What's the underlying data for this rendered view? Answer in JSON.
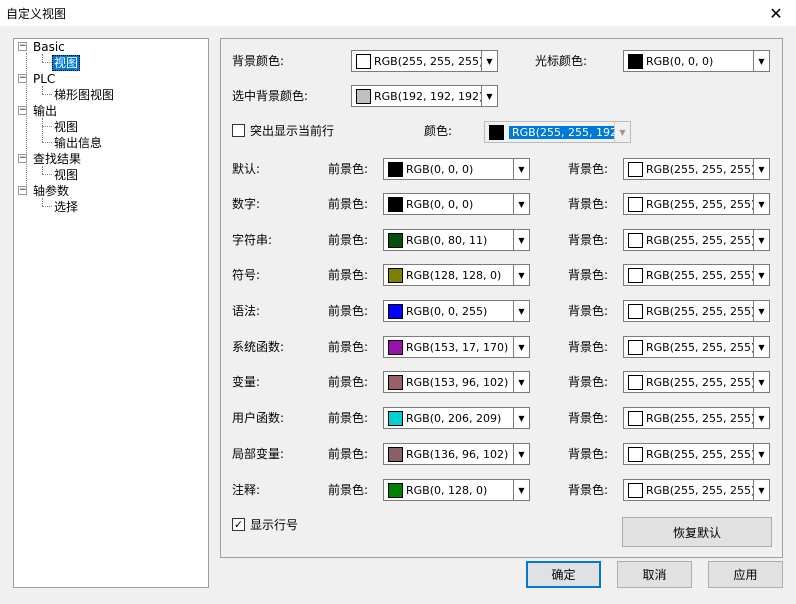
{
  "window": {
    "title": "自定义视图",
    "close_glyph": "✕"
  },
  "tree": [
    {
      "label": "Basic",
      "expander": "−"
    },
    {
      "label": "视图"
    },
    {
      "label": "PLC",
      "expander": "−"
    },
    {
      "label": "梯形图视图"
    },
    {
      "label": "输出",
      "expander": "−"
    },
    {
      "label": "视图"
    },
    {
      "label": "输出信息"
    },
    {
      "label": "查找结果",
      "expander": "−"
    },
    {
      "label": "视图"
    },
    {
      "label": "轴参数",
      "expander": "−"
    },
    {
      "label": "选择"
    }
  ],
  "top": {
    "bg_label": "背景颜色:",
    "bg_value": "RGB(255, 255, 255)",
    "bg_color": "#ffffff",
    "cursor_label": "光标颜色:",
    "cursor_value": "RGB(0, 0, 0)",
    "cursor_color": "#000000",
    "selbg_label": "选中背景颜色:",
    "selbg_value": "RGB(192, 192, 192)",
    "selbg_color": "#c0c0c0",
    "highlight_label": "突出显示当前行",
    "highlight_checked": false,
    "color_label": "颜色:",
    "color_value": "RGB(255, 255, 192)",
    "color_color": "#000000"
  },
  "fg_label": "前景色:",
  "bgc_label": "背景色:",
  "rows": [
    {
      "name": "默认:",
      "fg": "RGB(0, 0, 0)",
      "fg_color": "#000000",
      "bg": "RGB(255, 255, 255)",
      "bg_color": "#ffffff"
    },
    {
      "name": "数字:",
      "fg": "RGB(0, 0, 0)",
      "fg_color": "#000000",
      "bg": "RGB(255, 255, 255)",
      "bg_color": "#ffffff"
    },
    {
      "name": "字符串:",
      "fg": "RGB(0, 80, 11)",
      "fg_color": "#00500b",
      "bg": "RGB(255, 255, 255)",
      "bg_color": "#ffffff"
    },
    {
      "name": "符号:",
      "fg": "RGB(128, 128, 0)",
      "fg_color": "#808000",
      "bg": "RGB(255, 255, 255)",
      "bg_color": "#ffffff"
    },
    {
      "name": "语法:",
      "fg": "RGB(0, 0, 255)",
      "fg_color": "#0000ff",
      "bg": "RGB(255, 255, 255)",
      "bg_color": "#ffffff"
    },
    {
      "name": "系统函数:",
      "fg": "RGB(153, 17, 170)",
      "fg_color": "#9911aa",
      "bg": "RGB(255, 255, 255)",
      "bg_color": "#ffffff"
    },
    {
      "name": "变量:",
      "fg": "RGB(153, 96, 102)",
      "fg_color": "#996066",
      "bg": "RGB(255, 255, 255)",
      "bg_color": "#ffffff"
    },
    {
      "name": "用户函数:",
      "fg": "RGB(0, 206, 209)",
      "fg_color": "#00ced1",
      "bg": "RGB(255, 255, 255)",
      "bg_color": "#ffffff"
    },
    {
      "name": "局部变量:",
      "fg": "RGB(136, 96, 102)",
      "fg_color": "#886066",
      "bg": "RGB(255, 255, 255)",
      "bg_color": "#ffffff"
    },
    {
      "name": "注释:",
      "fg": "RGB(0, 128, 0)",
      "fg_color": "#008000",
      "bg": "RGB(255, 255, 255)",
      "bg_color": "#ffffff"
    }
  ],
  "show_line_numbers": {
    "label": "显示行号",
    "checked": true,
    "mark": "✓"
  },
  "buttons": {
    "restore": "恢复默认",
    "ok": "确定",
    "cancel": "取消",
    "apply": "应用"
  },
  "dropdown_glyph": "▼"
}
